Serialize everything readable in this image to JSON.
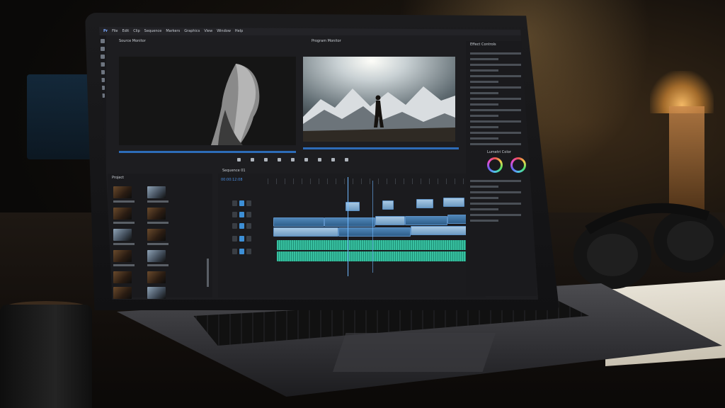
{
  "app": {
    "menu": [
      "Pr",
      "File",
      "Edit",
      "Clip",
      "Sequence",
      "Markers",
      "Graphics",
      "View",
      "Window",
      "Help"
    ]
  },
  "panels": {
    "source_monitor": "Source Monitor",
    "program_monitor": "Program Monitor",
    "project": "Project",
    "timeline": "Sequence 01",
    "effect_controls": "Effect Controls",
    "lumetri": "Lumetri Color"
  },
  "timeline": {
    "timecode": "00:00:12:08"
  },
  "icons": {
    "tools": [
      "selection-icon",
      "track-select-icon",
      "ripple-edit-icon",
      "razor-icon",
      "slip-icon",
      "pen-icon",
      "hand-icon",
      "type-icon"
    ],
    "transport": [
      "marker-icon",
      "in-point-icon",
      "out-point-icon",
      "step-back-icon",
      "play-icon",
      "step-forward-icon",
      "lift-icon",
      "extract-icon",
      "export-frame-icon"
    ]
  },
  "colors": {
    "accent_blue": "#3d8fd6",
    "clip_blue": "#4f86b8",
    "audio_green": "#37c0a0",
    "playhead": "#6fb8ff"
  }
}
